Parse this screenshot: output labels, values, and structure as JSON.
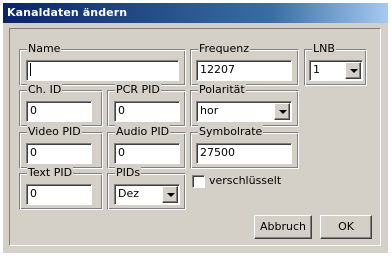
{
  "window": {
    "title": "Kanaldaten ändern"
  },
  "fields": {
    "name": {
      "label": "Name",
      "value": ""
    },
    "frequenz": {
      "label": "Frequenz",
      "value": "12207"
    },
    "lnb": {
      "label": "LNB",
      "value": "1"
    },
    "ch_id": {
      "label": "Ch. ID",
      "value": "0"
    },
    "pcr_pid": {
      "label": "PCR PID",
      "value": "0"
    },
    "polaritaet": {
      "label": "Polarität",
      "value": "hor"
    },
    "video_pid": {
      "label": "Video PID",
      "value": "0"
    },
    "audio_pid": {
      "label": "Audio PID",
      "value": "0"
    },
    "symbolrate": {
      "label": "Symbolrate",
      "value": "27500"
    },
    "text_pid": {
      "label": "Text PID",
      "value": "0"
    },
    "pids": {
      "label": "PIDs",
      "value": "Dez"
    }
  },
  "checkbox": {
    "label": "verschlüsselt",
    "checked": false
  },
  "buttons": {
    "cancel": "Abbruch",
    "ok": "OK"
  }
}
